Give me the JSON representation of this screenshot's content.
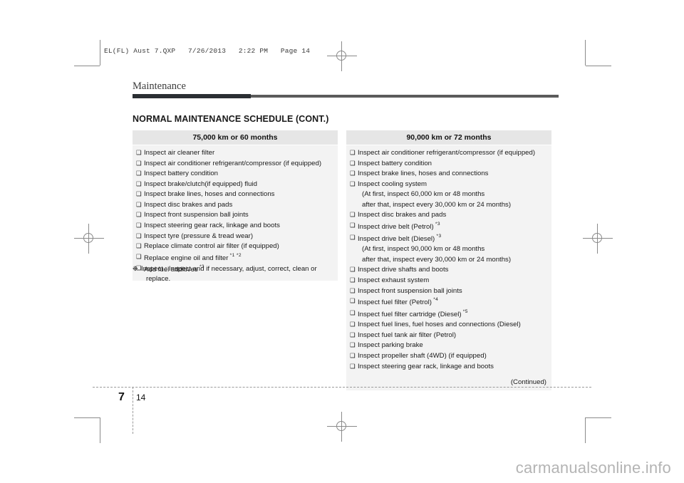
{
  "print_slug": {
    "text": "EL(FL) Aust 7.QXP   7/26/2013   2:22 PM   Page 14"
  },
  "chapter": {
    "title": "Maintenance"
  },
  "section": {
    "title": "NORMAL MAINTENANCE SCHEDULE (CONT.)"
  },
  "tables": [
    {
      "id": "schedule-75000km",
      "header": "75,000 km or 60 months",
      "items": [
        {
          "text": "Inspect air cleaner filter",
          "bulleted": true,
          "sup": ""
        },
        {
          "text": "Inspect air conditioner refrigerant/compressor (if equipped)",
          "bulleted": true,
          "sup": ""
        },
        {
          "text": "Inspect battery condition",
          "bulleted": true,
          "sup": ""
        },
        {
          "text": "Inspect brake/clutch(if equipped) fluid",
          "bulleted": true,
          "sup": ""
        },
        {
          "text": "Inspect brake lines, hoses and connections",
          "bulleted": true,
          "sup": ""
        },
        {
          "text": "Inspect disc brakes and pads",
          "bulleted": true,
          "sup": ""
        },
        {
          "text": "Inspect front suspension ball joints",
          "bulleted": true,
          "sup": ""
        },
        {
          "text": "Inspect steering gear rack, linkage and boots",
          "bulleted": true,
          "sup": ""
        },
        {
          "text": "Inspect tyre (pressure & tread wear)",
          "bulleted": true,
          "sup": ""
        },
        {
          "text": "Replace climate control air filter (if equipped)",
          "bulleted": true,
          "sup": ""
        },
        {
          "text": "Replace engine oil and filter",
          "bulleted": true,
          "sup": "*1 *2"
        },
        {
          "text": "Add fuel additives",
          "bulleted": true,
          "sup": "*3"
        }
      ],
      "continued": ""
    },
    {
      "id": "schedule-90000km",
      "header": "90,000 km or 72 months",
      "items": [
        {
          "text": "Inspect air conditioner refrigerant/compressor (if equipped)",
          "bulleted": true,
          "sup": ""
        },
        {
          "text": "Inspect battery condition",
          "bulleted": true,
          "sup": ""
        },
        {
          "text": "Inspect brake lines, hoses and connections",
          "bulleted": true,
          "sup": ""
        },
        {
          "text": "Inspect cooling system",
          "bulleted": true,
          "sup": ""
        },
        {
          "text": "(At first, inspect 60,000 km or 48 months",
          "bulleted": false,
          "sup": ""
        },
        {
          "text": "after that, inspect every 30,000 km or 24 months)",
          "bulleted": false,
          "sup": ""
        },
        {
          "text": "Inspect disc brakes and pads",
          "bulleted": true,
          "sup": ""
        },
        {
          "text": "Inspect drive belt (Petrol)",
          "bulleted": true,
          "sup": "*3"
        },
        {
          "text": "Inspect drive belt (Diesel)",
          "bulleted": true,
          "sup": "*3"
        },
        {
          "text": "(At first, inspect 90,000 km or 48 months",
          "bulleted": false,
          "sup": ""
        },
        {
          "text": "after that, inspect every 30,000 km or 24 months)",
          "bulleted": false,
          "sup": ""
        },
        {
          "text": "Inspect drive shafts and boots",
          "bulleted": true,
          "sup": ""
        },
        {
          "text": "Inspect exhaust system",
          "bulleted": true,
          "sup": ""
        },
        {
          "text": "Inspect front suspension ball joints",
          "bulleted": true,
          "sup": ""
        },
        {
          "text": "Inspect fuel filter (Petrol)",
          "bulleted": true,
          "sup": "*4"
        },
        {
          "text": "Inspect fuel filter cartridge (Diesel)",
          "bulleted": true,
          "sup": "*5"
        },
        {
          "text": "Inspect fuel lines, fuel hoses and connections (Diesel)",
          "bulleted": true,
          "sup": ""
        },
        {
          "text": "Inspect fuel tank air filter (Petrol)",
          "bulleted": true,
          "sup": ""
        },
        {
          "text": "Inspect parking brake",
          "bulleted": true,
          "sup": ""
        },
        {
          "text": "Inspect propeller shaft (4WD) (if equipped)",
          "bulleted": true,
          "sup": ""
        },
        {
          "text": "Inspect steering gear rack, linkage and boots",
          "bulleted": true,
          "sup": ""
        }
      ],
      "continued": "(Continued)"
    }
  ],
  "footnote": {
    "mark": "❉",
    "line1": "Inspect : Inspect and if necessary, adjust, correct, clean or",
    "line2": "replace."
  },
  "footer": {
    "chapter_number": "7",
    "page_number": "14"
  },
  "watermark": {
    "text": "carmanualsonline.info"
  },
  "colors": {
    "table_header_bg": "#e6e6e6",
    "table_body_bg": "#f3f3f3",
    "chapter_rule": "#5b5b5b",
    "chapter_tab": "#2b2f33",
    "text": "#1a1a1a",
    "watermark": "#b4b4b4",
    "crop_mark": "#8a8a8a"
  }
}
